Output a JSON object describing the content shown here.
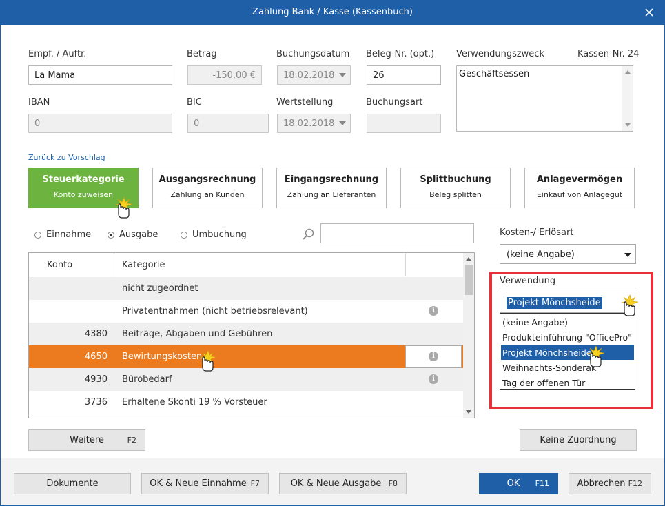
{
  "window": {
    "title": "Zahlung Bank / Kasse (Kassenbuch)",
    "close_glyph": "✕"
  },
  "form": {
    "empf_label": "Empf. / Auftr.",
    "empf_value": "La Mama",
    "betrag_label": "Betrag",
    "betrag_value": "-150,00 €",
    "buchungsdatum_label": "Buchungsdatum",
    "buchungsdatum_value": "18.02.2018",
    "beleg_label": "Beleg-Nr. (opt.)",
    "beleg_value": "26",
    "verwendungszweck_label": "Verwendungszweck",
    "verwendungszweck_value": "Geschäftsessen",
    "kassen_nr": "Kassen-Nr. 24",
    "iban_label": "IBAN",
    "iban_value": "0",
    "bic_label": "BIC",
    "bic_value": "0",
    "wertstellung_label": "Wertstellung",
    "wertstellung_value": "18.02.2018",
    "buchungsart_label": "Buchungsart",
    "buchungsart_value": ""
  },
  "back_link": "Zurück zu Vorschlag",
  "category_buttons": [
    {
      "title": "Steuerkategorie",
      "subtitle": "Konto zuweisen"
    },
    {
      "title": "Ausgangsrechnung",
      "subtitle": "Zahlung an Kunden"
    },
    {
      "title": "Eingangsrechnung",
      "subtitle": "Zahlung an Lieferanten"
    },
    {
      "title": "Splittbuchung",
      "subtitle": "Beleg splitten"
    },
    {
      "title": "Anlagevermögen",
      "subtitle": "Einkauf von Anlagegut"
    }
  ],
  "radios": [
    {
      "label": "Einnahme",
      "checked": false
    },
    {
      "label": "Ausgabe",
      "checked": true
    },
    {
      "label": "Umbuchung",
      "checked": false
    }
  ],
  "search": {
    "value": ""
  },
  "table": {
    "headers": [
      "Konto",
      "Kategorie"
    ],
    "rows": [
      {
        "konto": "",
        "kategorie": "nicht zugeordnet",
        "info": false
      },
      {
        "konto": "",
        "kategorie": "Privatentnahmen  (nicht betriebsrelevant)",
        "info": true
      },
      {
        "konto": "4380",
        "kategorie": "Beiträge, Abgaben und Gebühren",
        "info": false
      },
      {
        "konto": "4650",
        "kategorie": "Bewirtungskosten",
        "info": true,
        "selected": true
      },
      {
        "konto": "4930",
        "kategorie": "Bürobedarf",
        "info": true
      },
      {
        "konto": "3736",
        "kategorie": "Erhaltene Skonti 19 % Vorsteuer",
        "info": false
      }
    ],
    "info_glyph": "i"
  },
  "kosten": {
    "label": "Kosten-/ Erlösart",
    "value": "(keine Angabe)"
  },
  "verwendung": {
    "label": "Verwendung",
    "selected": "Projekt Mönchsheide",
    "options": [
      "(keine Angabe)",
      "Produkteinführung \"OfficePro\"",
      "Projekt Mönchsheide",
      "Weihnachts-Sonderak",
      "Tag der offenen Tür"
    ],
    "highlighted_index": 2
  },
  "buttons": {
    "weitere": "Weitere",
    "weitere_key": "F2",
    "keine_zuordnung": "Keine Zuordnung",
    "dokumente": "Dokumente",
    "ok_neue_einnahme": "OK & Neue Einnahme",
    "ok_neue_einnahme_key": "F7",
    "ok_neue_ausgabe": "OK & Neue Ausgabe",
    "ok_neue_ausgabe_key": "F8",
    "ok": "OK",
    "ok_key": "F11",
    "abbrechen": "Abbrechen",
    "abbrechen_key": "F12"
  },
  "colors": {
    "accent": "#1e5fa8",
    "active_green": "#6db33f",
    "row_selected": "#ec7a1e",
    "highlight_box": "#e8303a"
  }
}
